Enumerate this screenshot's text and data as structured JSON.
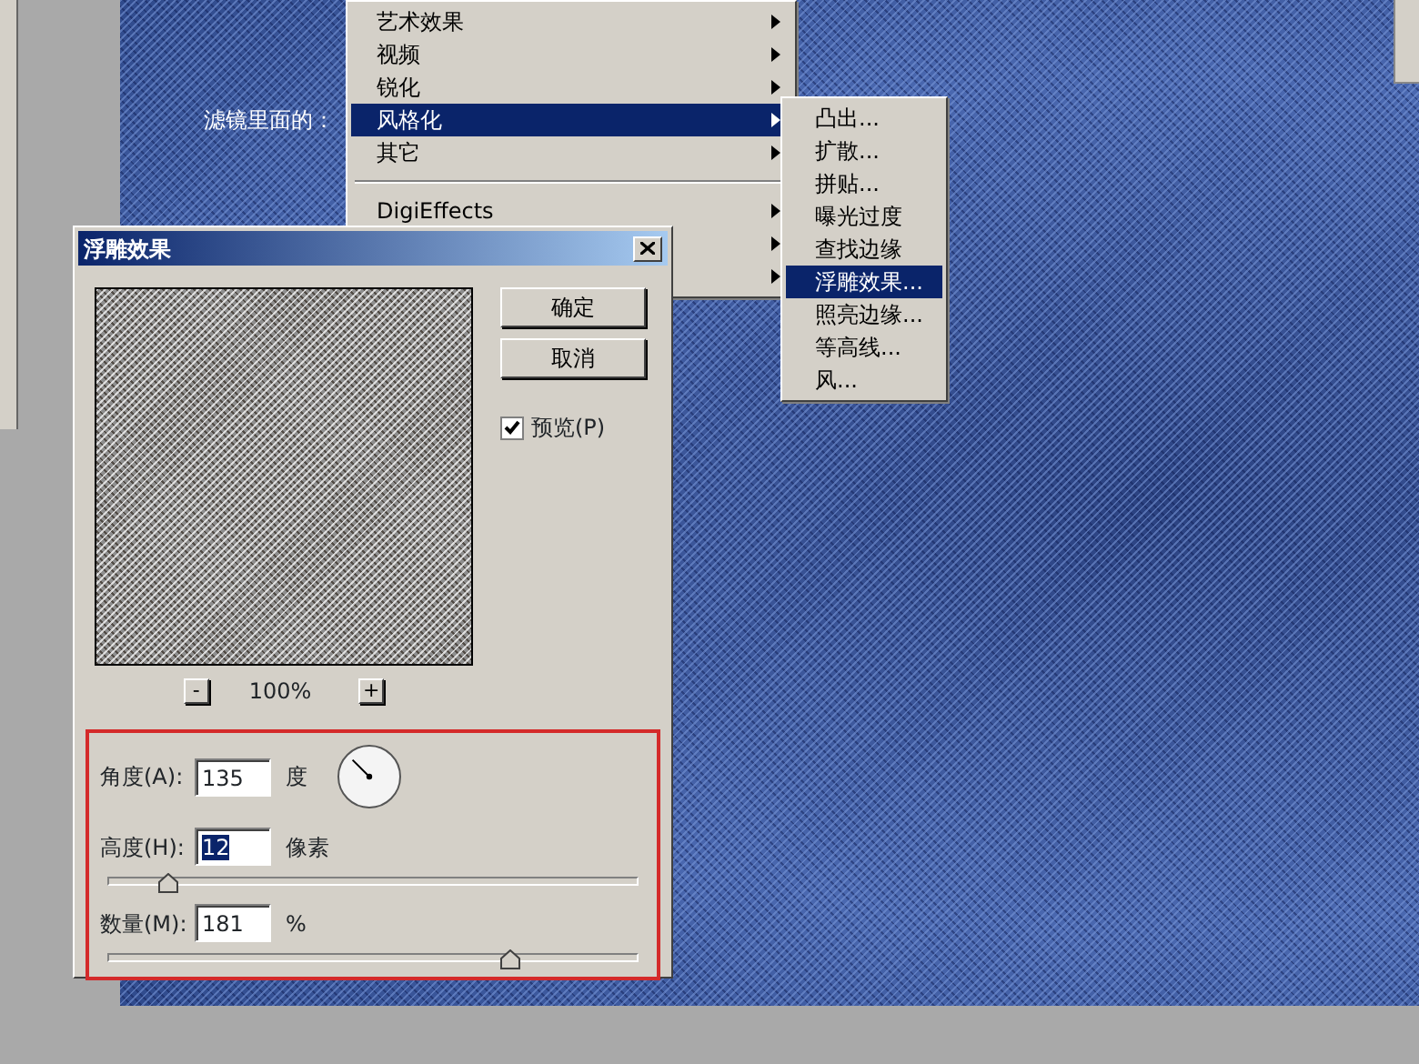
{
  "canvas_label": "滤镜里面的：",
  "menu": {
    "items": [
      {
        "kind": "item",
        "label": "艺术效果",
        "submenu": true,
        "selected": false
      },
      {
        "kind": "item",
        "label": "视频",
        "submenu": true,
        "selected": false
      },
      {
        "kind": "item",
        "label": "锐化",
        "submenu": true,
        "selected": false
      },
      {
        "kind": "item",
        "label": "风格化",
        "submenu": true,
        "selected": true
      },
      {
        "kind": "item",
        "label": "其它",
        "submenu": true,
        "selected": false
      },
      {
        "kind": "separator"
      },
      {
        "kind": "item",
        "label": "DigiEffects",
        "submenu": true,
        "selected": false
      },
      {
        "kind": "covered",
        "submenu": true
      },
      {
        "kind": "covered",
        "submenu": true
      }
    ]
  },
  "submenu": {
    "items": [
      {
        "label": "凸出...",
        "selected": false
      },
      {
        "label": "扩散...",
        "selected": false
      },
      {
        "label": "拼贴...",
        "selected": false
      },
      {
        "label": "曝光过度",
        "selected": false
      },
      {
        "label": "查找边缘",
        "selected": false
      },
      {
        "label": "浮雕效果...",
        "selected": true
      },
      {
        "label": "照亮边缘...",
        "selected": false
      },
      {
        "label": "等高线...",
        "selected": false
      },
      {
        "label": "风...",
        "selected": false
      }
    ]
  },
  "dialog": {
    "title": "浮雕效果",
    "buttons": [
      "确定",
      "取消"
    ],
    "preview": {
      "label": "预览(P)",
      "checked": true
    },
    "zoom": {
      "minus": "-",
      "value": "100%",
      "plus": "+"
    },
    "params": [
      {
        "kind": "dial",
        "label": "角度(A):",
        "value": "135",
        "unit": "度",
        "value_selected": false
      },
      {
        "kind": "slider",
        "label": "高度(H):",
        "value": "12",
        "unit": "像素",
        "value_selected": true,
        "level": 0.11
      },
      {
        "kind": "slider",
        "label": "数量(M):",
        "value": "181",
        "unit": "%",
        "value_selected": false,
        "level": 0.76
      }
    ]
  }
}
